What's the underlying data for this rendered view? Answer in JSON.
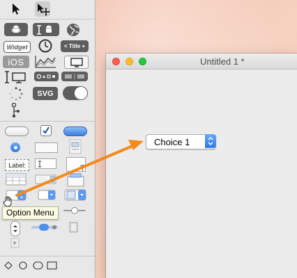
{
  "window": {
    "title": "Untitled 1 *"
  },
  "popup_control": {
    "selected_value": "Choice 1"
  },
  "tooltip": {
    "text": "Option Menu"
  },
  "palette": {
    "widget_label": "Widget",
    "title_label": "< Title +",
    "ios_label": "iOS",
    "svg_label": "SVG",
    "label_tool": "Label:"
  },
  "colors": {
    "accent_blue": "#2f7ae6",
    "arrow_orange": "#f28a1e",
    "close_red": "#fe5f57",
    "minimize_yellow": "#febc2e",
    "zoom_green": "#28c840"
  }
}
